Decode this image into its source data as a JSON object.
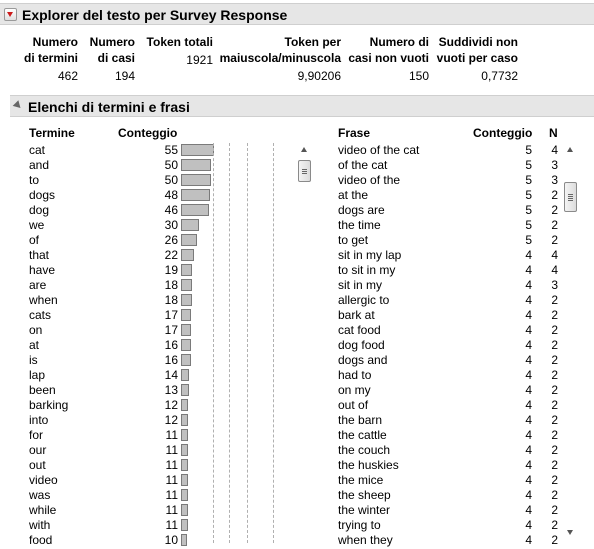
{
  "report": {
    "title": "Explorer del testo per Survey Response"
  },
  "summary": {
    "headers": [
      [
        "Numero",
        "di termini"
      ],
      [
        "Numero",
        "di casi"
      ],
      [
        "",
        "Token totali"
      ],
      [
        "Token per",
        "maiuscola/minuscola"
      ],
      [
        "Numero di",
        "casi non vuoti"
      ],
      [
        "Suddividi non",
        "vuoti per caso"
      ]
    ],
    "values": [
      "462",
      "194",
      "1921",
      "9,90206",
      "150",
      "0,7732"
    ]
  },
  "lists_section": {
    "title": "Elenchi di termini e frasi"
  },
  "terms": {
    "header_term": "Termine",
    "header_count": "Conteggio",
    "rows": [
      {
        "term": "cat",
        "count": "55",
        "value": 55
      },
      {
        "term": "and",
        "count": "50",
        "value": 50
      },
      {
        "term": "to",
        "count": "50",
        "value": 50
      },
      {
        "term": "dogs",
        "count": "48",
        "value": 48
      },
      {
        "term": "dog",
        "count": "46",
        "value": 46
      },
      {
        "term": "we",
        "count": "30",
        "value": 30
      },
      {
        "term": "of",
        "count": "26",
        "value": 26
      },
      {
        "term": "that",
        "count": "22",
        "value": 22
      },
      {
        "term": "have",
        "count": "19",
        "value": 19
      },
      {
        "term": "are",
        "count": "18",
        "value": 18
      },
      {
        "term": "when",
        "count": "18",
        "value": 18
      },
      {
        "term": "cats",
        "count": "17",
        "value": 17
      },
      {
        "term": "on",
        "count": "17",
        "value": 17
      },
      {
        "term": "at",
        "count": "16",
        "value": 16
      },
      {
        "term": "is",
        "count": "16",
        "value": 16
      },
      {
        "term": "lap",
        "count": "14",
        "value": 14
      },
      {
        "term": "been",
        "count": "13",
        "value": 13
      },
      {
        "term": "barking",
        "count": "12",
        "value": 12
      },
      {
        "term": "into",
        "count": "12",
        "value": 12
      },
      {
        "term": "for",
        "count": "11",
        "value": 11
      },
      {
        "term": "our",
        "count": "11",
        "value": 11
      },
      {
        "term": "out",
        "count": "11",
        "value": 11
      },
      {
        "term": "video",
        "count": "11",
        "value": 11
      },
      {
        "term": "was",
        "count": "11",
        "value": 11
      },
      {
        "term": "while",
        "count": "11",
        "value": 11
      },
      {
        "term": "with",
        "count": "11",
        "value": 11
      },
      {
        "term": "food",
        "count": "10",
        "value": 10
      }
    ]
  },
  "phrases": {
    "header_phrase": "Frase",
    "header_count": "Conteggio",
    "header_n": "N",
    "rows": [
      {
        "phrase": "video of the cat",
        "count": "5",
        "n": "4"
      },
      {
        "phrase": "of the cat",
        "count": "5",
        "n": "3"
      },
      {
        "phrase": "video of the",
        "count": "5",
        "n": "3"
      },
      {
        "phrase": "at the",
        "count": "5",
        "n": "2"
      },
      {
        "phrase": "dogs are",
        "count": "5",
        "n": "2"
      },
      {
        "phrase": "the time",
        "count": "5",
        "n": "2"
      },
      {
        "phrase": "to get",
        "count": "5",
        "n": "2"
      },
      {
        "phrase": "sit in my lap",
        "count": "4",
        "n": "4"
      },
      {
        "phrase": "to sit in my",
        "count": "4",
        "n": "4"
      },
      {
        "phrase": "sit in my",
        "count": "4",
        "n": "3"
      },
      {
        "phrase": "allergic to",
        "count": "4",
        "n": "2"
      },
      {
        "phrase": "bark at",
        "count": "4",
        "n": "2"
      },
      {
        "phrase": "cat food",
        "count": "4",
        "n": "2"
      },
      {
        "phrase": "dog food",
        "count": "4",
        "n": "2"
      },
      {
        "phrase": "dogs and",
        "count": "4",
        "n": "2"
      },
      {
        "phrase": "had to",
        "count": "4",
        "n": "2"
      },
      {
        "phrase": "on my",
        "count": "4",
        "n": "2"
      },
      {
        "phrase": "out of",
        "count": "4",
        "n": "2"
      },
      {
        "phrase": "the barn",
        "count": "4",
        "n": "2"
      },
      {
        "phrase": "the cattle",
        "count": "4",
        "n": "2"
      },
      {
        "phrase": "the couch",
        "count": "4",
        "n": "2"
      },
      {
        "phrase": "the huskies",
        "count": "4",
        "n": "2"
      },
      {
        "phrase": "the mice",
        "count": "4",
        "n": "2"
      },
      {
        "phrase": "the sheep",
        "count": "4",
        "n": "2"
      },
      {
        "phrase": "the winter",
        "count": "4",
        "n": "2"
      },
      {
        "phrase": "trying to",
        "count": "4",
        "n": "2"
      },
      {
        "phrase": "when they",
        "count": "4",
        "n": "2"
      }
    ]
  },
  "colors": {
    "header_bg": "#e6e6e6",
    "menu_triangle": "#cc1b1b",
    "bar_fill": "#c0c0c0",
    "bar_border": "#7a7a7a"
  },
  "icons": {
    "menu": "red-down-triangle",
    "disclosure": "gray-down-triangle",
    "scroll_up": "up-arrow",
    "scroll_down": "down-arrow"
  }
}
